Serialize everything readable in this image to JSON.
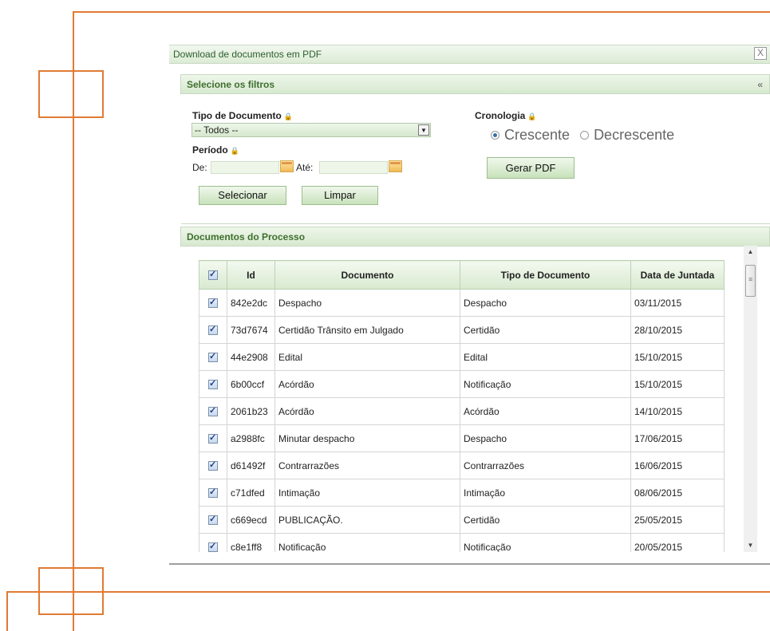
{
  "dialog": {
    "title": "Download de documentos em PDF",
    "close_label": "X"
  },
  "filters": {
    "header": "Selecione os filtros",
    "collapse_label": "«",
    "tipo_label": "Tipo de Documento",
    "tipo_selected": "-- Todos --",
    "periodo_label": "Período",
    "de_label": "De:",
    "ate_label": "Até:",
    "de_value": "",
    "ate_value": "",
    "cronologia_label": "Cronologia",
    "crescente_label": "Crescente",
    "decrescente_label": "Decrescente",
    "cronologia_selected": "Crescente",
    "selecionar_button": "Selecionar",
    "limpar_button": "Limpar",
    "gerar_pdf_button": "Gerar PDF"
  },
  "documents": {
    "header": "Documentos do Processo",
    "columns": [
      "Id",
      "Documento",
      "Tipo de Documento",
      "Data de Juntada"
    ],
    "rows": [
      {
        "id": "842e2dc",
        "documento": "Despacho",
        "tipo": "Despacho",
        "data": "03/11/2015",
        "checked": true
      },
      {
        "id": "73d7674",
        "documento": "Certidão Trânsito em Julgado",
        "tipo": "Certidão",
        "data": "28/10/2015",
        "checked": true
      },
      {
        "id": "44e2908",
        "documento": "Edital",
        "tipo": "Edital",
        "data": "15/10/2015",
        "checked": true
      },
      {
        "id": "6b00ccf",
        "documento": "Acórdão",
        "tipo": "Notificação",
        "data": "15/10/2015",
        "checked": true
      },
      {
        "id": "2061b23",
        "documento": "Acórdão",
        "tipo": "Acórdão",
        "data": "14/10/2015",
        "checked": true
      },
      {
        "id": "a2988fc",
        "documento": "Minutar despacho",
        "tipo": "Despacho",
        "data": "17/06/2015",
        "checked": true
      },
      {
        "id": "d61492f",
        "documento": "Contrarrazões",
        "tipo": "Contrarrazões",
        "data": "16/06/2015",
        "checked": true
      },
      {
        "id": "c71dfed",
        "documento": "Intimação",
        "tipo": "Intimação",
        "data": "08/06/2015",
        "checked": true
      },
      {
        "id": "c669ecd",
        "documento": "PUBLICAÇÃO.",
        "tipo": "Certidão",
        "data": "25/05/2015",
        "checked": true
      },
      {
        "id": "c8e1ff8",
        "documento": "Notificação",
        "tipo": "Notificação",
        "data": "20/05/2015",
        "checked": true
      }
    ]
  },
  "colors": {
    "accent_orange": "#e07b34",
    "header_green": "#3f6f2f",
    "panel_green": "#d7e9cf"
  }
}
